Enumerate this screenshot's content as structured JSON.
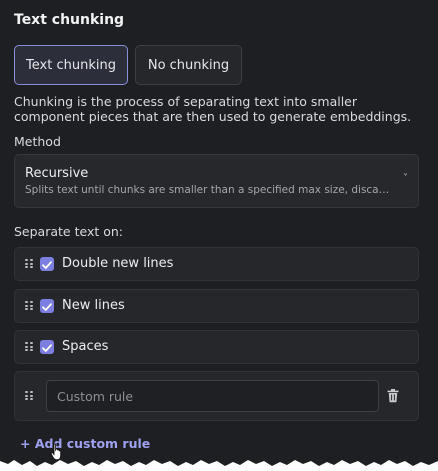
{
  "section": {
    "title": "Text chunking"
  },
  "chunking_toggle": {
    "options": [
      "Text chunking",
      "No chunking"
    ],
    "selected": "Text chunking"
  },
  "description": "Chunking is the process of separating text into smaller component pieces that are then used to generate embeddings.",
  "method": {
    "label": "Method",
    "value": "Recursive",
    "hint": "Splits text until chunks are smaller than a specified max size, discards o..."
  },
  "separators": {
    "label": "Separate text on:",
    "rules": [
      {
        "label": "Double new lines",
        "checked": true
      },
      {
        "label": "New lines",
        "checked": true
      },
      {
        "label": "Spaces",
        "checked": true
      }
    ],
    "custom_rule": {
      "placeholder": "Custom rule",
      "value": ""
    },
    "add_rule_label": "+ Add custom rule"
  },
  "colors": {
    "accent": "#7d7fe0",
    "link": "#9ea1f0",
    "background": "#1e1f22"
  }
}
